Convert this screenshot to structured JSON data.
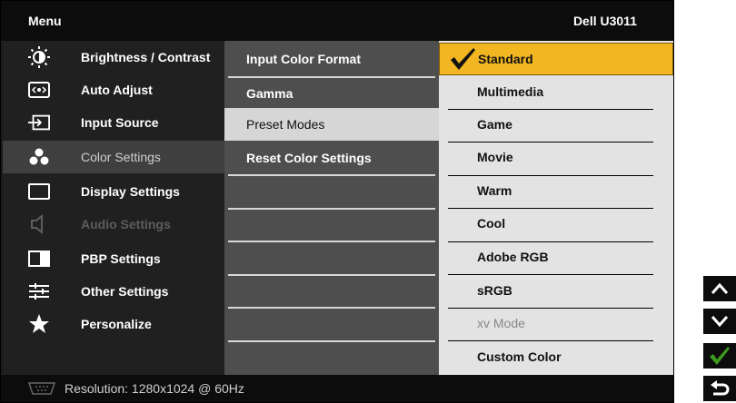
{
  "header": {
    "menu_label": "Menu",
    "model": "Dell U3011"
  },
  "sidebar": {
    "items": [
      {
        "label": "Brightness / Contrast",
        "icon": "brightness-icon"
      },
      {
        "label": "Auto Adjust",
        "icon": "auto-adjust-icon"
      },
      {
        "label": "Input Source",
        "icon": "input-source-icon"
      },
      {
        "label": "Color Settings",
        "icon": "color-settings-icon",
        "state": "active"
      },
      {
        "label": "Display Settings",
        "icon": "display-icon"
      },
      {
        "label": "Audio Settings",
        "icon": "speaker-icon",
        "state": "disabled"
      },
      {
        "label": "PBP Settings",
        "icon": "pbp-icon"
      },
      {
        "label": "Other Settings",
        "icon": "sliders-icon"
      },
      {
        "label": "Personalize",
        "icon": "star-icon"
      }
    ]
  },
  "submenu": {
    "items": [
      {
        "label": "Input Color Format"
      },
      {
        "label": "Gamma"
      },
      {
        "label": "Preset Modes",
        "state": "selected"
      },
      {
        "label": "Reset Color Settings"
      }
    ]
  },
  "options": {
    "items": [
      {
        "label": "Standard",
        "state": "current"
      },
      {
        "label": "Multimedia"
      },
      {
        "label": "Game"
      },
      {
        "label": "Movie"
      },
      {
        "label": "Warm"
      },
      {
        "label": "Cool"
      },
      {
        "label": "Adobe RGB"
      },
      {
        "label": "sRGB"
      },
      {
        "label": "xv Mode",
        "state": "dim"
      },
      {
        "label": "Custom Color"
      }
    ]
  },
  "footer": {
    "resolution": "Resolution: 1280x1024 @ 60Hz",
    "icon": "vga-connector-icon"
  },
  "side_buttons": [
    {
      "name": "up-button",
      "icon": "chevron-up-icon"
    },
    {
      "name": "down-button",
      "icon": "chevron-down-icon"
    },
    {
      "name": "confirm-button",
      "icon": "checkmark-icon"
    },
    {
      "name": "back-button",
      "icon": "back-arrow-icon"
    }
  ],
  "colors": {
    "accent": "#f1b622",
    "check": "#3c9a1f",
    "panel": "#1b1b1b"
  }
}
